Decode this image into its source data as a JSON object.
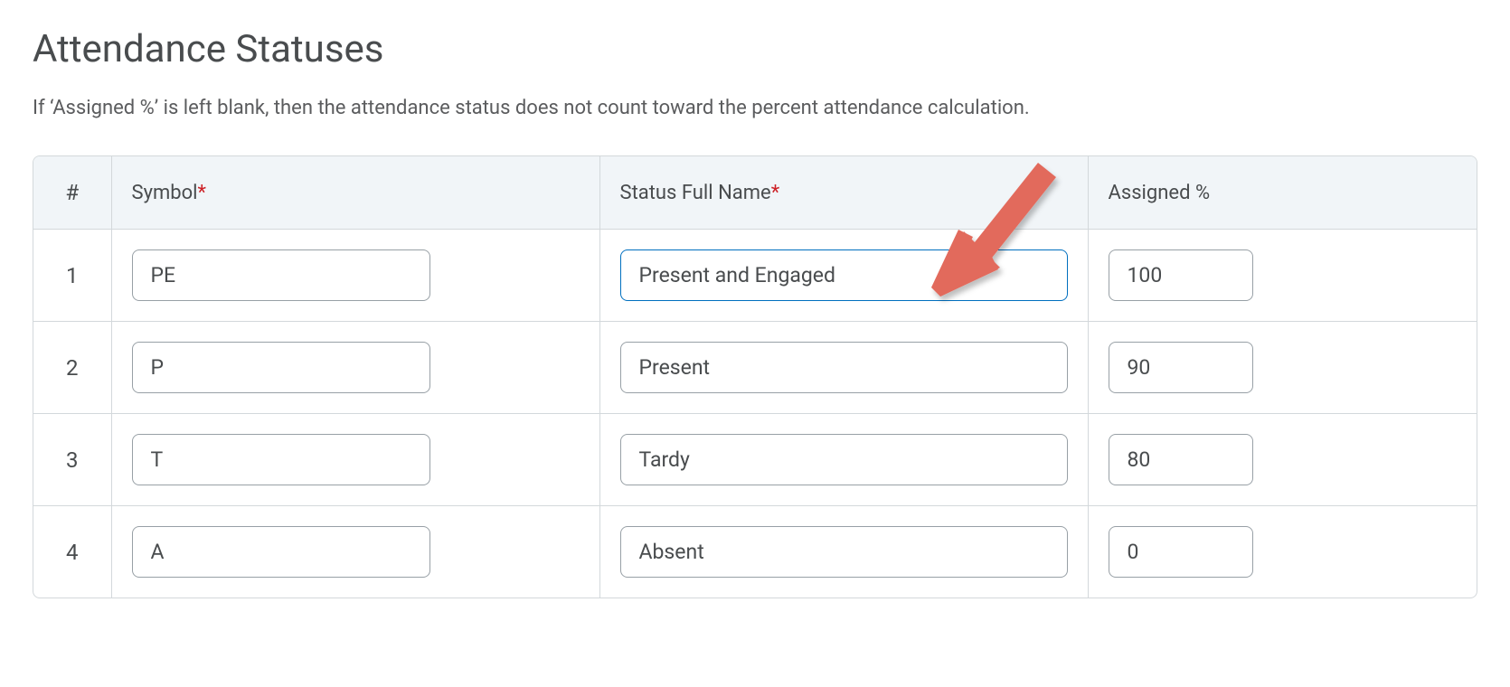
{
  "heading": "Attendance Statuses",
  "help": "If ‘Assigned %’ is left blank, then the attendance status does not count toward the percent attendance calculation.",
  "columns": {
    "num": "#",
    "symbol": "Symbol",
    "name": "Status Full Name",
    "pct": "Assigned %"
  },
  "required_marker": "*",
  "rows": [
    {
      "n": "1",
      "symbol": "PE",
      "name": "Present and Engaged",
      "pct": "100"
    },
    {
      "n": "2",
      "symbol": "P",
      "name": "Present",
      "pct": "90"
    },
    {
      "n": "3",
      "symbol": "T",
      "name": "Tardy",
      "pct": "80"
    },
    {
      "n": "4",
      "symbol": "A",
      "name": "Absent",
      "pct": "0"
    }
  ],
  "annotation": {
    "arrow_color": "#e26a5c"
  }
}
